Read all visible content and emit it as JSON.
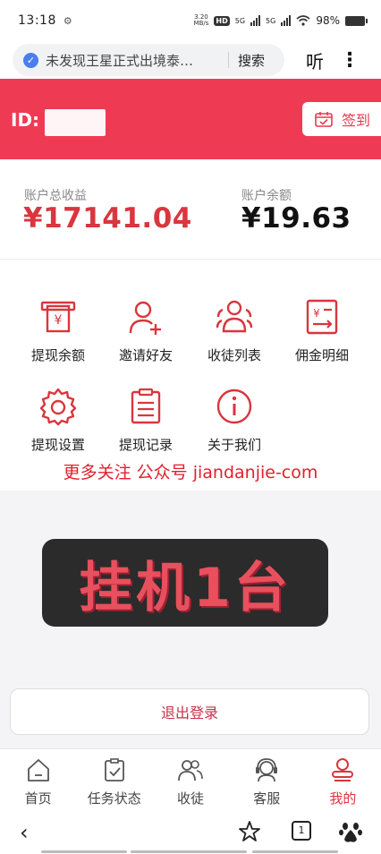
{
  "status": {
    "time": "13:18",
    "net_speed_top": "3.20",
    "net_speed_unit": "MB/s",
    "hd": "HD",
    "net1": "5G",
    "net2": "5G",
    "battery": "98%"
  },
  "browser": {
    "url_text": "未发现王星正式出境泰…",
    "search": "搜索",
    "listen": "听"
  },
  "header": {
    "id_label": "ID:",
    "signin": "签到",
    "accent_color": "#ee3b53"
  },
  "earnings": {
    "total_label": "账户总收益",
    "total_value": "¥17141.04",
    "balance_label": "账户余额",
    "balance_value": "¥19.63"
  },
  "menu": [
    {
      "label": "提现余额",
      "icon": "withdraw-icon"
    },
    {
      "label": "邀请好友",
      "icon": "invite-user-icon"
    },
    {
      "label": "收徒列表",
      "icon": "group-icon"
    },
    {
      "label": "佣金明细",
      "icon": "commission-icon"
    },
    {
      "label": "提现设置",
      "icon": "settings-icon"
    },
    {
      "label": "提现记录",
      "icon": "record-icon"
    },
    {
      "label": "关于我们",
      "icon": "info-icon"
    }
  ],
  "promo": "更多关注 公众号 jiandanjie-com",
  "banner": "挂机1台",
  "logout": "退出登录",
  "tabs": [
    {
      "label": "首页",
      "icon": "home-icon"
    },
    {
      "label": "任务状态",
      "icon": "task-icon"
    },
    {
      "label": "收徒",
      "icon": "disciples-icon"
    },
    {
      "label": "客服",
      "icon": "support-icon"
    },
    {
      "label": "我的",
      "icon": "profile-icon",
      "active": true
    }
  ],
  "nav": {
    "tab_count": "1"
  }
}
